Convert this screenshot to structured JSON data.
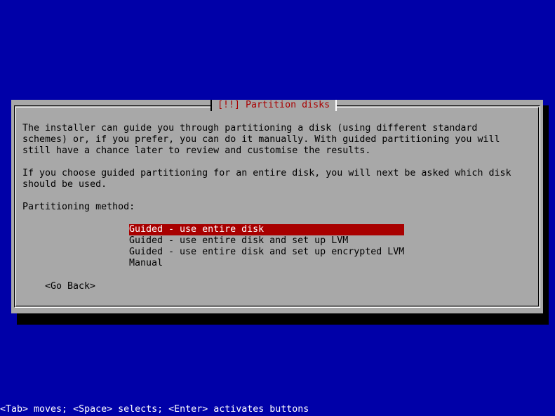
{
  "dialog": {
    "title": "[!!] Partition disks",
    "intro_lines": [
      "The installer can guide you through partitioning a disk (using different standard",
      "schemes) or, if you prefer, you can do it manually. With guided partitioning you will",
      "still have a chance later to review and customise the results."
    ],
    "guided_lines": [
      "If you choose guided partitioning for an entire disk, you will next be asked which disk",
      "should be used."
    ],
    "method_label": "Partitioning method:",
    "options": [
      {
        "label": "Guided - use entire disk",
        "selected": true
      },
      {
        "label": "Guided - use entire disk and set up LVM",
        "selected": false
      },
      {
        "label": "Guided - use entire disk and set up encrypted LVM",
        "selected": false
      },
      {
        "label": "Manual",
        "selected": false
      }
    ],
    "go_back_label": "<Go Back>"
  },
  "status_bar": {
    "text": "<Tab> moves; <Space> selects; <Enter> activates buttons"
  },
  "colors": {
    "background": "#0000a8",
    "dialog": "#a8a8a8",
    "title": "#a80000",
    "highlight": "#a80000"
  }
}
